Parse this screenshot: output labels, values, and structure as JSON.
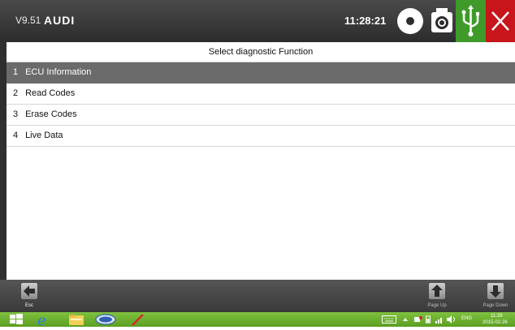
{
  "titlebar": {
    "version": "V9.51",
    "brand": "AUDI",
    "clock": "11:28:21"
  },
  "header": {
    "title": "Select diagnostic Function"
  },
  "menu": {
    "items": [
      {
        "num": "1",
        "label": "ECU Information",
        "selected": true
      },
      {
        "num": "2",
        "label": "Read Codes",
        "selected": false
      },
      {
        "num": "3",
        "label": "Erase Codes",
        "selected": false
      },
      {
        "num": "4",
        "label": "Live Data",
        "selected": false
      }
    ]
  },
  "toolbar": {
    "esc_label": "Esc",
    "page_up_label": "Page Up",
    "page_down_label": "Page Down"
  },
  "taskbar": {
    "language": "ENG",
    "time": "11:28",
    "date": "2015-02-26"
  },
  "colors": {
    "usb_button": "#3f9a2a",
    "close_button": "#c8141b",
    "selected_row": "#6b6b6b",
    "taskbar": "#6aae2e"
  },
  "icons": {
    "record": "record-icon",
    "camera": "camera-icon",
    "usb": "usb-icon",
    "close": "close-icon",
    "esc": "back-arrow-icon",
    "page_up": "up-arrow-icon",
    "page_down": "down-arrow-icon"
  }
}
